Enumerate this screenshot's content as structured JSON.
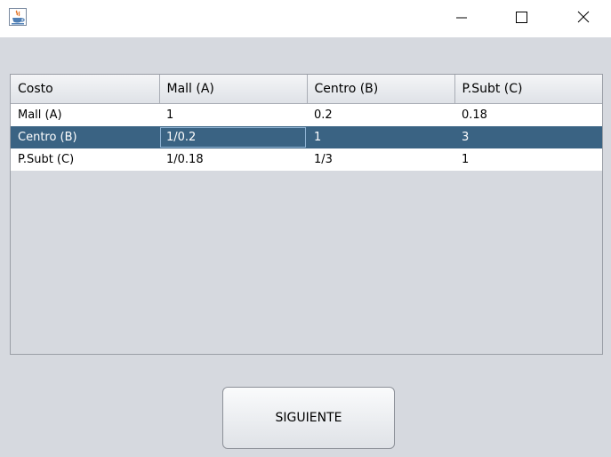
{
  "window": {
    "icon": "java-cup-icon",
    "controls": {
      "minimize": "minimize-icon",
      "maximize": "maximize-icon",
      "close": "close-icon"
    }
  },
  "table": {
    "headers": [
      "Costo",
      "Mall (A)",
      "Centro (B)",
      "P.Subt (C)"
    ],
    "rows": [
      [
        "Mall (A)",
        "1",
        "0.2",
        "0.18"
      ],
      [
        "Centro (B)",
        "1/0.2",
        "1",
        "3"
      ],
      [
        "P.Subt (C)",
        "1/0.18",
        "1/3",
        "1"
      ]
    ],
    "selected_row": 1,
    "selection_color": "#3a6383"
  },
  "button": {
    "label": "SIGUIENTE"
  }
}
